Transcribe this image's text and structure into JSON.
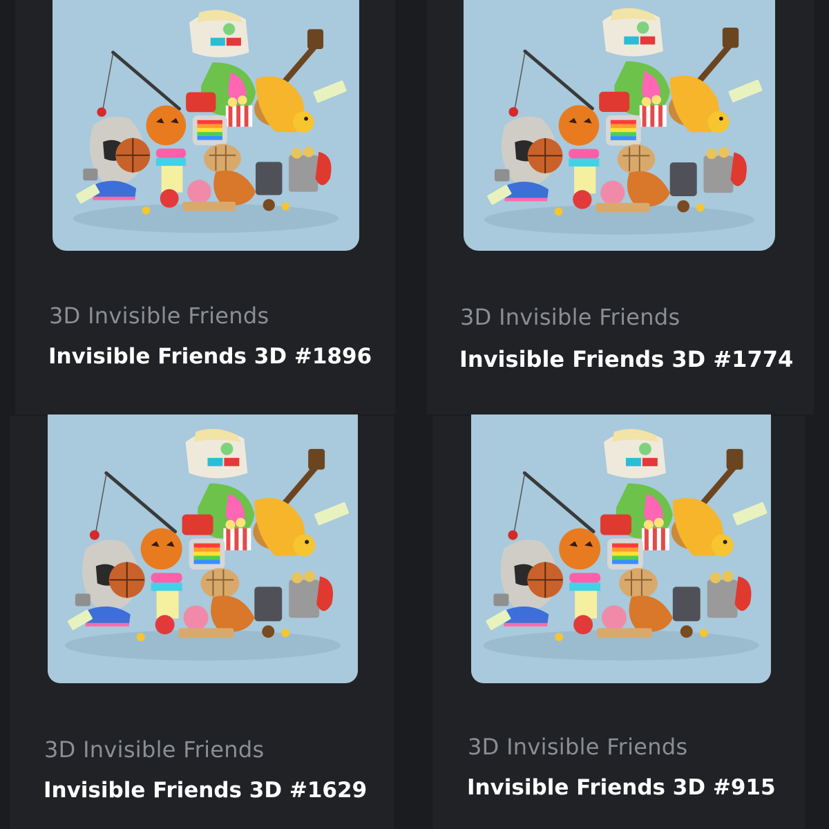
{
  "grid": {
    "cards": [
      {
        "collection": "3D Invisible Friends",
        "title": "Invisible Friends 3D #1896",
        "image": "invisible-friends-pile-artwork"
      },
      {
        "collection": "3D Invisible Friends",
        "title": "Invisible Friends 3D #1774",
        "image": "invisible-friends-pile-artwork"
      },
      {
        "collection": "3D Invisible Friends",
        "title": "Invisible Friends 3D #1629",
        "image": "invisible-friends-pile-artwork"
      },
      {
        "collection": "3D Invisible Friends",
        "title": "Invisible Friends 3D #915",
        "image": "invisible-friends-pile-artwork"
      }
    ]
  },
  "colors": {
    "page_background": "#1b1c20",
    "card_background": "#202226",
    "image_background": "#a9c9dc",
    "collection_text": "#8b8e94",
    "title_text": "#ffffff"
  }
}
